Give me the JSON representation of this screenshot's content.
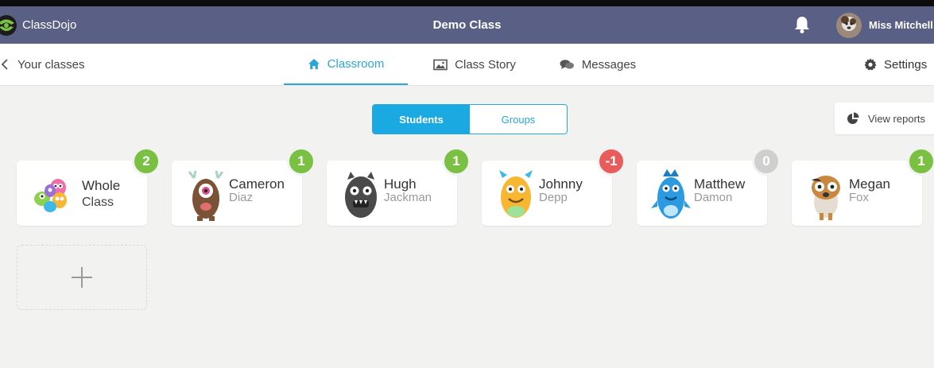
{
  "app": {
    "brand": "ClassDojo",
    "class_title": "Demo Class"
  },
  "user": {
    "name": "Miss Mitchell"
  },
  "nav": {
    "back_label": "Your classes",
    "tabs": [
      {
        "label": "Classroom",
        "active": true
      },
      {
        "label": "Class Story",
        "active": false
      },
      {
        "label": "Messages",
        "active": false
      }
    ],
    "settings_label": "Settings"
  },
  "view_toggle": {
    "students": "Students",
    "groups": "Groups",
    "selected": "Students"
  },
  "reports": {
    "label": "View reports"
  },
  "cards": [
    {
      "first": "Whole",
      "last": "Class",
      "points": "2",
      "badge_color": "#7ac143"
    },
    {
      "first": "Cameron",
      "last": "Diaz",
      "points": "1",
      "badge_color": "#7ac143"
    },
    {
      "first": "Hugh",
      "last": "Jackman",
      "points": "1",
      "badge_color": "#7ac143"
    },
    {
      "first": "Johnny",
      "last": "Depp",
      "points": "-1",
      "badge_color": "#e85c5c"
    },
    {
      "first": "Matthew",
      "last": "Damon",
      "points": "0",
      "badge_color": "#cfcfcf"
    },
    {
      "first": "Megan",
      "last": "Fox",
      "points": "1",
      "badge_color": "#7ac143"
    }
  ],
  "colors": {
    "header": "#5a5f86",
    "accent": "#1ba9e1",
    "positive": "#7ac143",
    "negative": "#e85c5c",
    "neutral": "#cfcfcf"
  },
  "icons": {
    "brand": "classdojo-logo",
    "bell": "bell-icon",
    "back": "chevron-left-icon",
    "tabs": [
      "home-icon",
      "picture-icon",
      "chat-bubbles-icon"
    ],
    "settings": "gear-icon",
    "reports": "pie-chart-icon",
    "add": "plus-icon"
  }
}
